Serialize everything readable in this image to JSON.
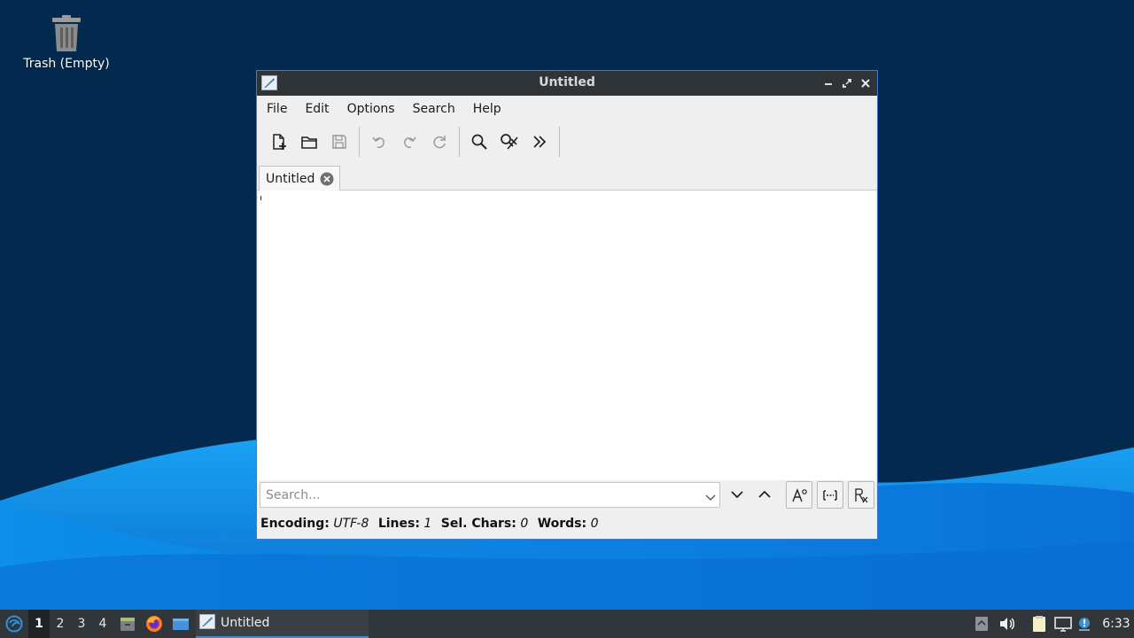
{
  "desktop": {
    "trash_label": "Trash (Empty)"
  },
  "window": {
    "title": "Untitled",
    "menu": [
      "File",
      "Edit",
      "Options",
      "Search",
      "Help"
    ],
    "toolbar_icons": [
      "new-document-icon",
      "open-folder-icon",
      "save-icon",
      "undo-icon",
      "redo-icon",
      "reload-icon",
      "find-icon",
      "find-replace-icon",
      "more-icon"
    ],
    "tab_label": "Untitled",
    "search": {
      "placeholder": "Search...",
      "value": ""
    },
    "status": {
      "encoding_label": "Encoding:",
      "encoding_value": "UTF-8",
      "lines_label": "Lines:",
      "lines_value": "1",
      "sel_label": "Sel. Chars:",
      "sel_value": "0",
      "words_label": "Words:",
      "words_value": "0"
    }
  },
  "taskbar": {
    "workspaces": [
      "1",
      "2",
      "3",
      "4"
    ],
    "active_workspace": "1",
    "task_label": "Untitled",
    "clock": "6:33"
  },
  "colors": {
    "desktop_dark": "#042a4f",
    "wave_blue": "#0a8fe6",
    "accent": "#3a8ed8",
    "titlebar": "#2f3438",
    "taskbar": "#31363b"
  }
}
